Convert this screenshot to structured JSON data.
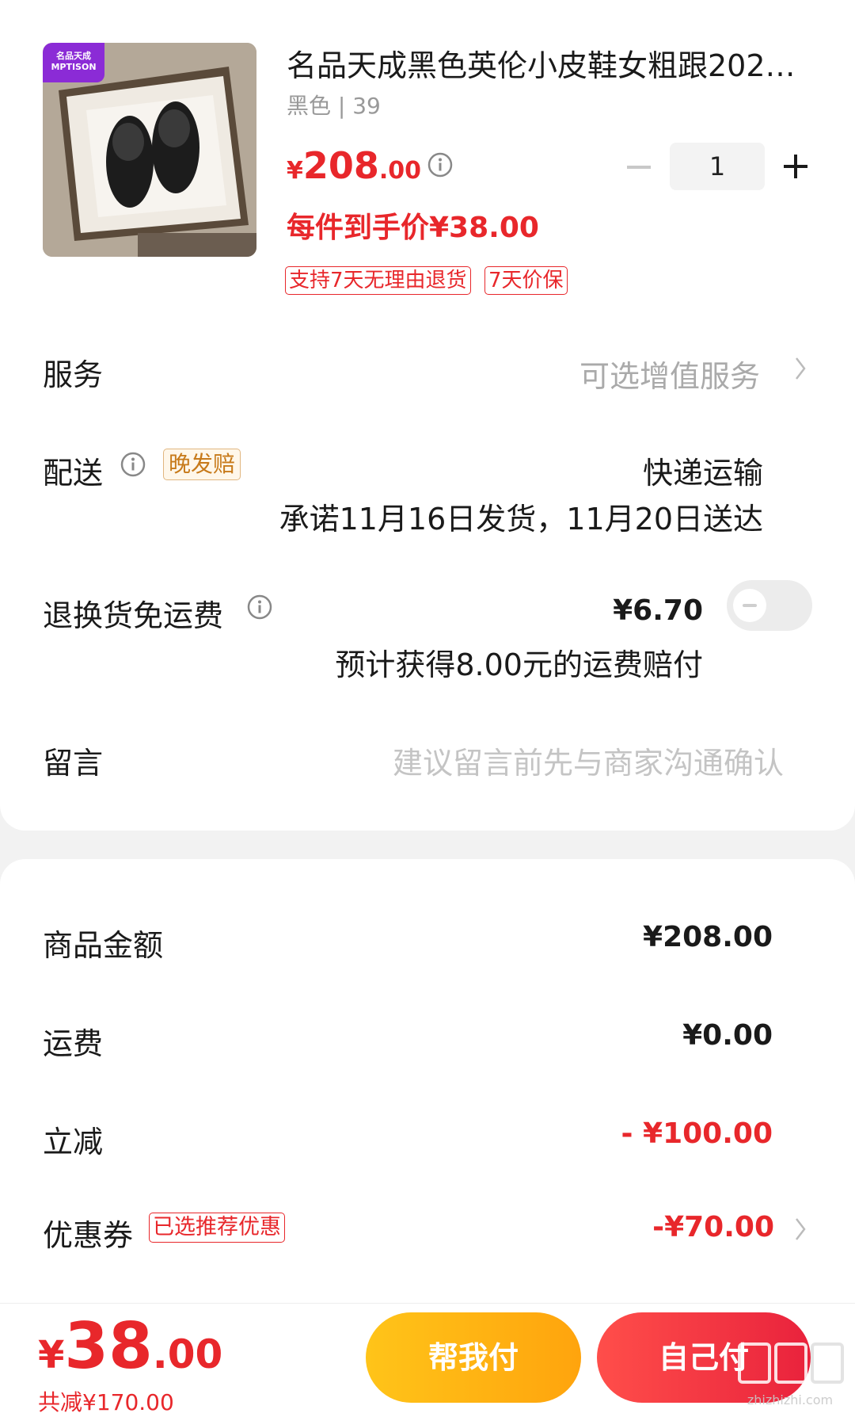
{
  "product": {
    "badge": "名品天成 MPTISON",
    "title": "名品天成黑色英伦小皮鞋女粗跟2023…",
    "sku": "黑色 | 39",
    "price_symbol": "¥",
    "price_int": "208",
    "price_dec": ".00",
    "quantity": "1",
    "net_price": "每件到手价¥38.00",
    "tags": [
      "支持7天无理由退货",
      "7天价保"
    ]
  },
  "rows": {
    "service_label": "服务",
    "service_value": "可选增值服务",
    "delivery_label": "配送",
    "delivery_tag": "晚发赔",
    "delivery_method": "快递运输",
    "delivery_promise": "承诺11月16日发货，11月20日送达",
    "return_label": "退换货免运费",
    "return_price": "¥6.70",
    "return_note": "预计获得8.00元的运费赔付",
    "message_label": "留言",
    "message_placeholder": "建议留言前先与商家沟通确认"
  },
  "summary": {
    "goods_label": "商品金额",
    "goods_value": "¥208.00",
    "shipping_label": "运费",
    "shipping_value": "¥0.00",
    "discount_label": "立减",
    "discount_value": "- ¥100.00",
    "coupon_label": "优惠券",
    "coupon_tag": "已选推荐优惠",
    "coupon_value": "-¥70.00"
  },
  "footer": {
    "total_symbol": "¥",
    "total_int": "38",
    "total_dec": ".00",
    "saved": "共减¥170.00",
    "help_pay": "帮我付",
    "self_pay": "自己付",
    "watermark": "值 zhizhizhi.com"
  },
  "colors": {
    "accent_red": "#e8272b",
    "button_yellow": "#ffb515",
    "button_red": "#f0303f",
    "tag_orange": "#c77a1a"
  },
  "icons": [
    "info-icon",
    "minus-icon",
    "plus-icon",
    "chevron-right-icon",
    "toggle-switch"
  ]
}
